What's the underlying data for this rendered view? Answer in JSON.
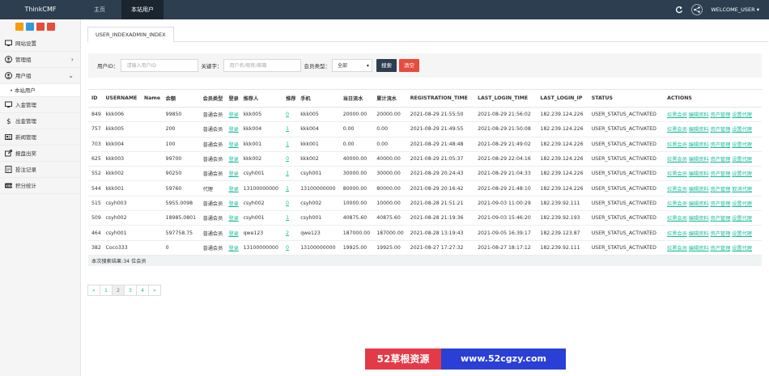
{
  "brand": "ThinkCMF",
  "topnav": {
    "home": "主页",
    "users": "本站用户",
    "welcome": "WELCOME_USER"
  },
  "colors": {
    "topbar": "#2c3e50",
    "accent": "#18bc9c",
    "search_btn": "#2c3e50",
    "clear_btn": "#e74c3c",
    "tool_1": "#f39c12",
    "tool_2": "#3498db",
    "tool_3": "#e74c3c",
    "tool_4": "#e74c3c"
  },
  "sidebar": {
    "items": [
      {
        "label": "网站设置",
        "icon": "monitor-icon"
      },
      {
        "label": "管理组",
        "icon": "user-circle-icon",
        "expand": "›"
      },
      {
        "label": "用户组",
        "icon": "user-circle-icon",
        "expand": "⌄"
      }
    ],
    "subitem": "• 本站用户",
    "items2": [
      {
        "label": "入金管理",
        "icon": "monitor-icon"
      },
      {
        "label": "出金管理",
        "icon": "dollar-icon"
      },
      {
        "label": "新闻管理",
        "icon": "news-icon"
      },
      {
        "label": "报盘出奖",
        "icon": "share-icon"
      },
      {
        "label": "投注记录",
        "icon": "doc-icon"
      },
      {
        "label": "积分统计",
        "icon": "visa-icon"
      }
    ]
  },
  "tab": "USER_INDEXADMIN_INDEX",
  "filter": {
    "uid_label": "用户ID：",
    "uid_placeholder": "请输入用户ID",
    "kw_label": "关键字：",
    "kw_placeholder": "用户名/昵称/邮箱",
    "type_label": "会员类型：",
    "type_value": "全部",
    "search_label": "搜索",
    "clear_label": "清空"
  },
  "table": {
    "headers": [
      "ID",
      "USERNAME",
      "Name",
      "余额",
      "会员类型",
      "登录",
      "推荐人",
      "推荐",
      "手机",
      "当日流水",
      "累计流水",
      "REGISTRATION_TIME",
      "LAST_LOGIN_TIME",
      "LAST_LOGIN_IP",
      "STATUS",
      "ACTIONS"
    ],
    "login_link": "登录",
    "actions": [
      "拉黑会员",
      "编辑资料",
      "资产管理",
      "设置代理"
    ],
    "actions_alt": [
      "拉黑会员",
      "编辑资料",
      "资产管理",
      "取消代理"
    ],
    "rows": [
      [
        "849",
        "kkk006",
        "",
        "99850",
        "普通会员",
        "登录",
        "kkk005",
        "0",
        "kkk005",
        "20000.00",
        "20000.00",
        "2021-08-29 21:55:50",
        "2021-08-29 21:56:02",
        "182.239.124.226",
        "USER_STATUS_ACTIVATED"
      ],
      [
        "757",
        "kkk005",
        "",
        "200",
        "普通会员",
        "登录",
        "kkk004",
        "1",
        "kkk004",
        "0.00",
        "0.00",
        "2021-08-29 21:49:55",
        "2021-08-29 21:50:08",
        "182.239.124.226",
        "USER_STATUS_ACTIVATED"
      ],
      [
        "703",
        "kkk004",
        "",
        "100",
        "普通会员",
        "登录",
        "kkk001",
        "1",
        "kkk001",
        "0.00",
        "0.00",
        "2021-08-29 21:48:48",
        "2021-08-29 21:49:02",
        "182.239.124.226",
        "USER_STATUS_ACTIVATED"
      ],
      [
        "625",
        "kkk003",
        "",
        "99700",
        "普通会员",
        "登录",
        "kkk002",
        "0",
        "kkk002",
        "40000.00",
        "40000.00",
        "2021-08-29 21:05:37",
        "2021-08-29 22:04:16",
        "182.239.124.226",
        "USER_STATUS_ACTIVATED"
      ],
      [
        "552",
        "kkk002",
        "",
        "90250",
        "普通会员",
        "登录",
        "csyh001",
        "1",
        "csyh001",
        "30000.00",
        "30000.00",
        "2021-08-29 20:24:43",
        "2021-08-29 21:04:33",
        "182.239.124.226",
        "USER_STATUS_ACTIVATED"
      ],
      [
        "544",
        "kkk001",
        "",
        "59760",
        "代理",
        "登录",
        "13100000000",
        "1",
        "13100000000",
        "80000.00",
        "80000.00",
        "2021-08-29 20:16:42",
        "2021-08-29 21:48:10",
        "182.239.124.226",
        "USER_STATUS_ACTIVATED"
      ],
      [
        "515",
        "csyh003",
        "",
        "5955.0098",
        "普通会员",
        "登录",
        "csyh002",
        "0",
        "csyh002",
        "10000.00",
        "10000.00",
        "2021-08-28 21:51:21",
        "2021-09-03 11:00:29",
        "182.239.92.111",
        "USER_STATUS_ACTIVATED"
      ],
      [
        "509",
        "csyh002",
        "",
        "18985.0801",
        "普通会员",
        "登录",
        "csyh001",
        "1",
        "csyh001",
        "40875.60",
        "40875.60",
        "2021-08-28 21:19:36",
        "2021-09-03 15:46:20",
        "182.239.92.193",
        "USER_STATUS_ACTIVATED"
      ],
      [
        "464",
        "csyh001",
        "",
        "597758.75",
        "普通会员",
        "登录",
        "qwe123",
        "2",
        "qwe123",
        "187000.00",
        "187000.00",
        "2021-08-28 13:19:43",
        "2021-09-05 16:39:17",
        "182.239.123.87",
        "USER_STATUS_ACTIVATED"
      ],
      [
        "382",
        "Coco333",
        "",
        "0",
        "普通会员",
        "登录",
        "13100000000",
        "0",
        "13100000000",
        "19925.00",
        "19925.00",
        "2021-08-27 17:27:32",
        "2021-08-27 18:17:12",
        "182.239.92.111",
        "USER_STATUS_ACTIVATED"
      ]
    ],
    "footer": "本次搜索结果:34 位会员"
  },
  "pager": [
    "«",
    "1",
    "2",
    "3",
    "4",
    "»"
  ],
  "watermark": {
    "left": "52草根资源",
    "right": "www.52cgzy.com"
  }
}
